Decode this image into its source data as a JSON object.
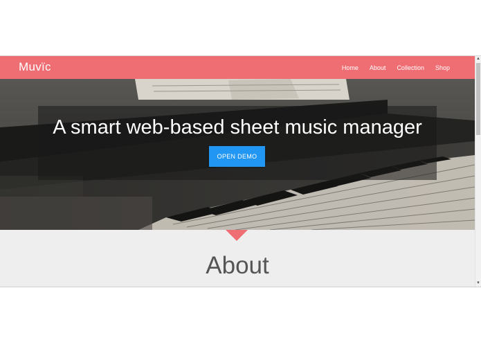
{
  "navbar": {
    "brand": "Muvïc",
    "links": [
      "Home",
      "About",
      "Collection",
      "Shop"
    ]
  },
  "hero": {
    "title": "A smart web-based sheet music manager",
    "button_label": "OPEN DEMO"
  },
  "about": {
    "heading": "About"
  },
  "colors": {
    "brand": "#ef6e73",
    "button": "#2196f3",
    "section_bg": "#eeeeee"
  },
  "icons": {
    "scroll_up": "triangle-up-icon",
    "scroll_down": "triangle-down-icon"
  }
}
